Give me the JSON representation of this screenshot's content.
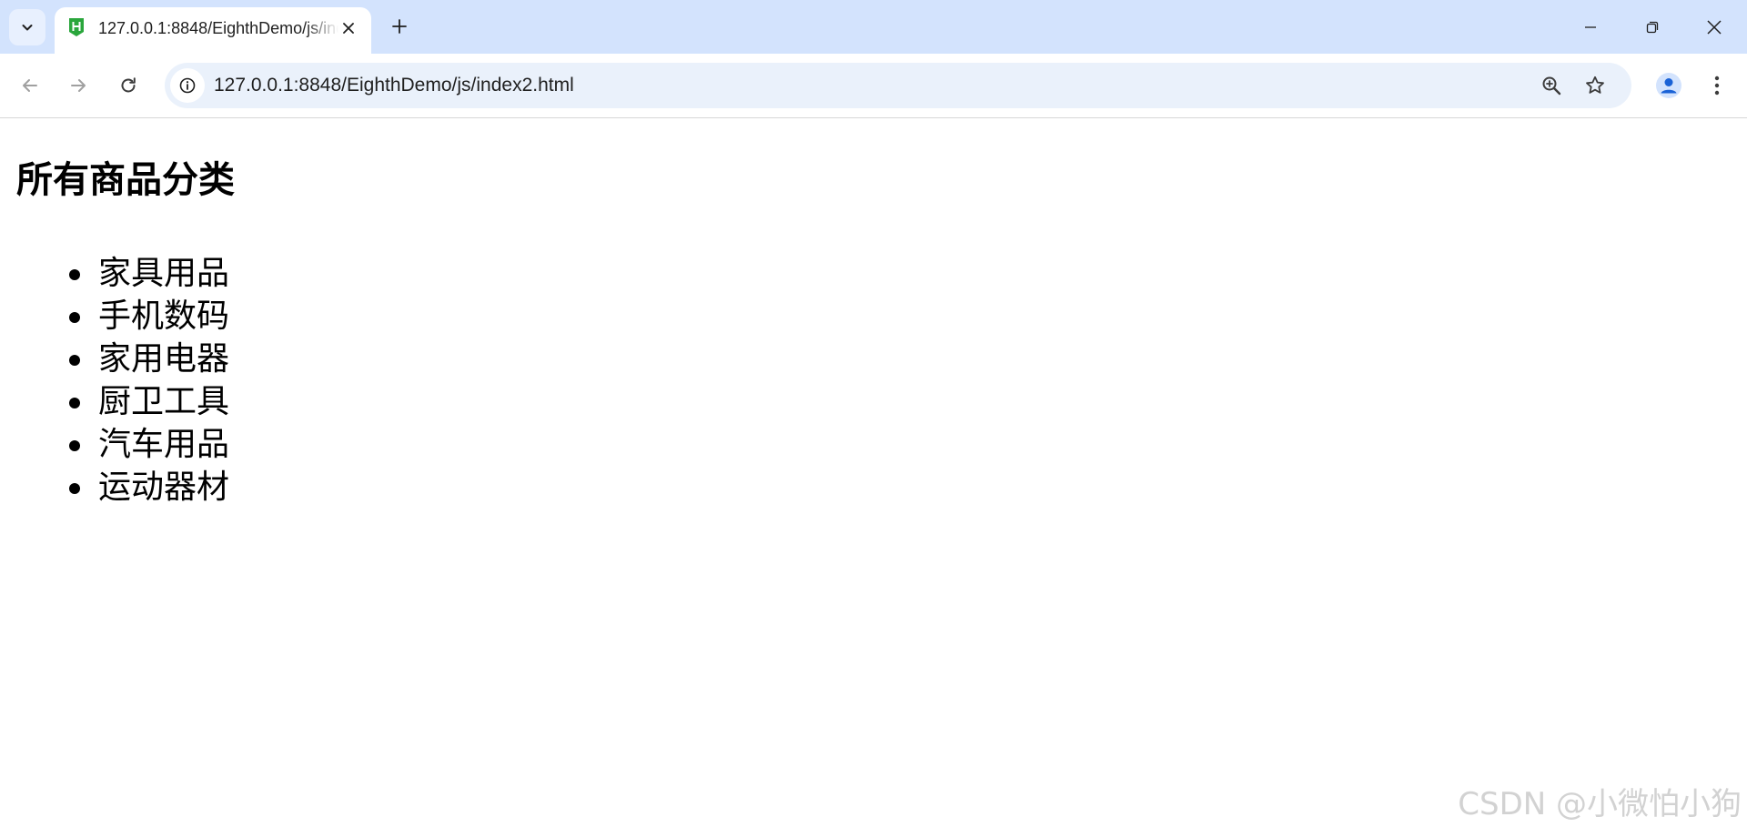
{
  "browser": {
    "tab": {
      "title": "127.0.0.1:8848/EighthDemo/js/index2.html",
      "favicon": "hbuilder-h-icon"
    },
    "address_bar": {
      "url": "127.0.0.1:8848/EighthDemo/js/index2.html"
    },
    "colors": {
      "tabstrip": "#d3e3fd",
      "omnibox": "#eaf1fb",
      "favicon_green": "#2aa63c",
      "profile_blue": "#1a62d6"
    }
  },
  "page": {
    "heading": "所有商品分类",
    "categories": [
      "家具用品",
      "手机数码",
      "家用电器",
      "厨卫工具",
      "汽车用品",
      "运动器材"
    ]
  },
  "watermark": "CSDN @小微怕小狗"
}
